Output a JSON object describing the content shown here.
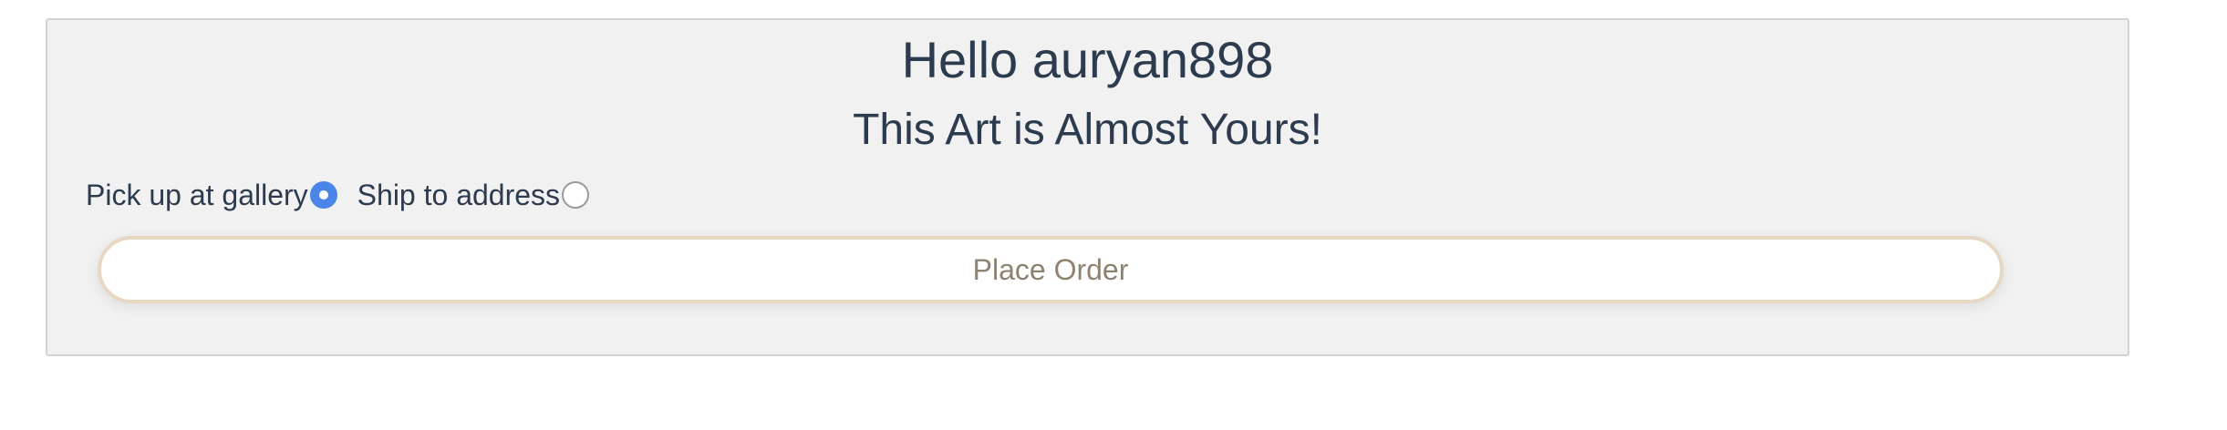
{
  "header": {
    "greeting": "Hello auryan898",
    "subtitle": "This Art is Almost Yours!"
  },
  "delivery": {
    "options": [
      {
        "label": "Pick up at gallery",
        "checked": true
      },
      {
        "label": "Ship to address",
        "checked": false
      }
    ]
  },
  "actions": {
    "place_order_label": "Place Order"
  },
  "colors": {
    "heading_text": "#2d3b4e",
    "radio_selected": "#4a86e8",
    "button_border": "#e6d8c3",
    "button_text": "#8e8270",
    "panel_background": "#f1f1f1"
  }
}
